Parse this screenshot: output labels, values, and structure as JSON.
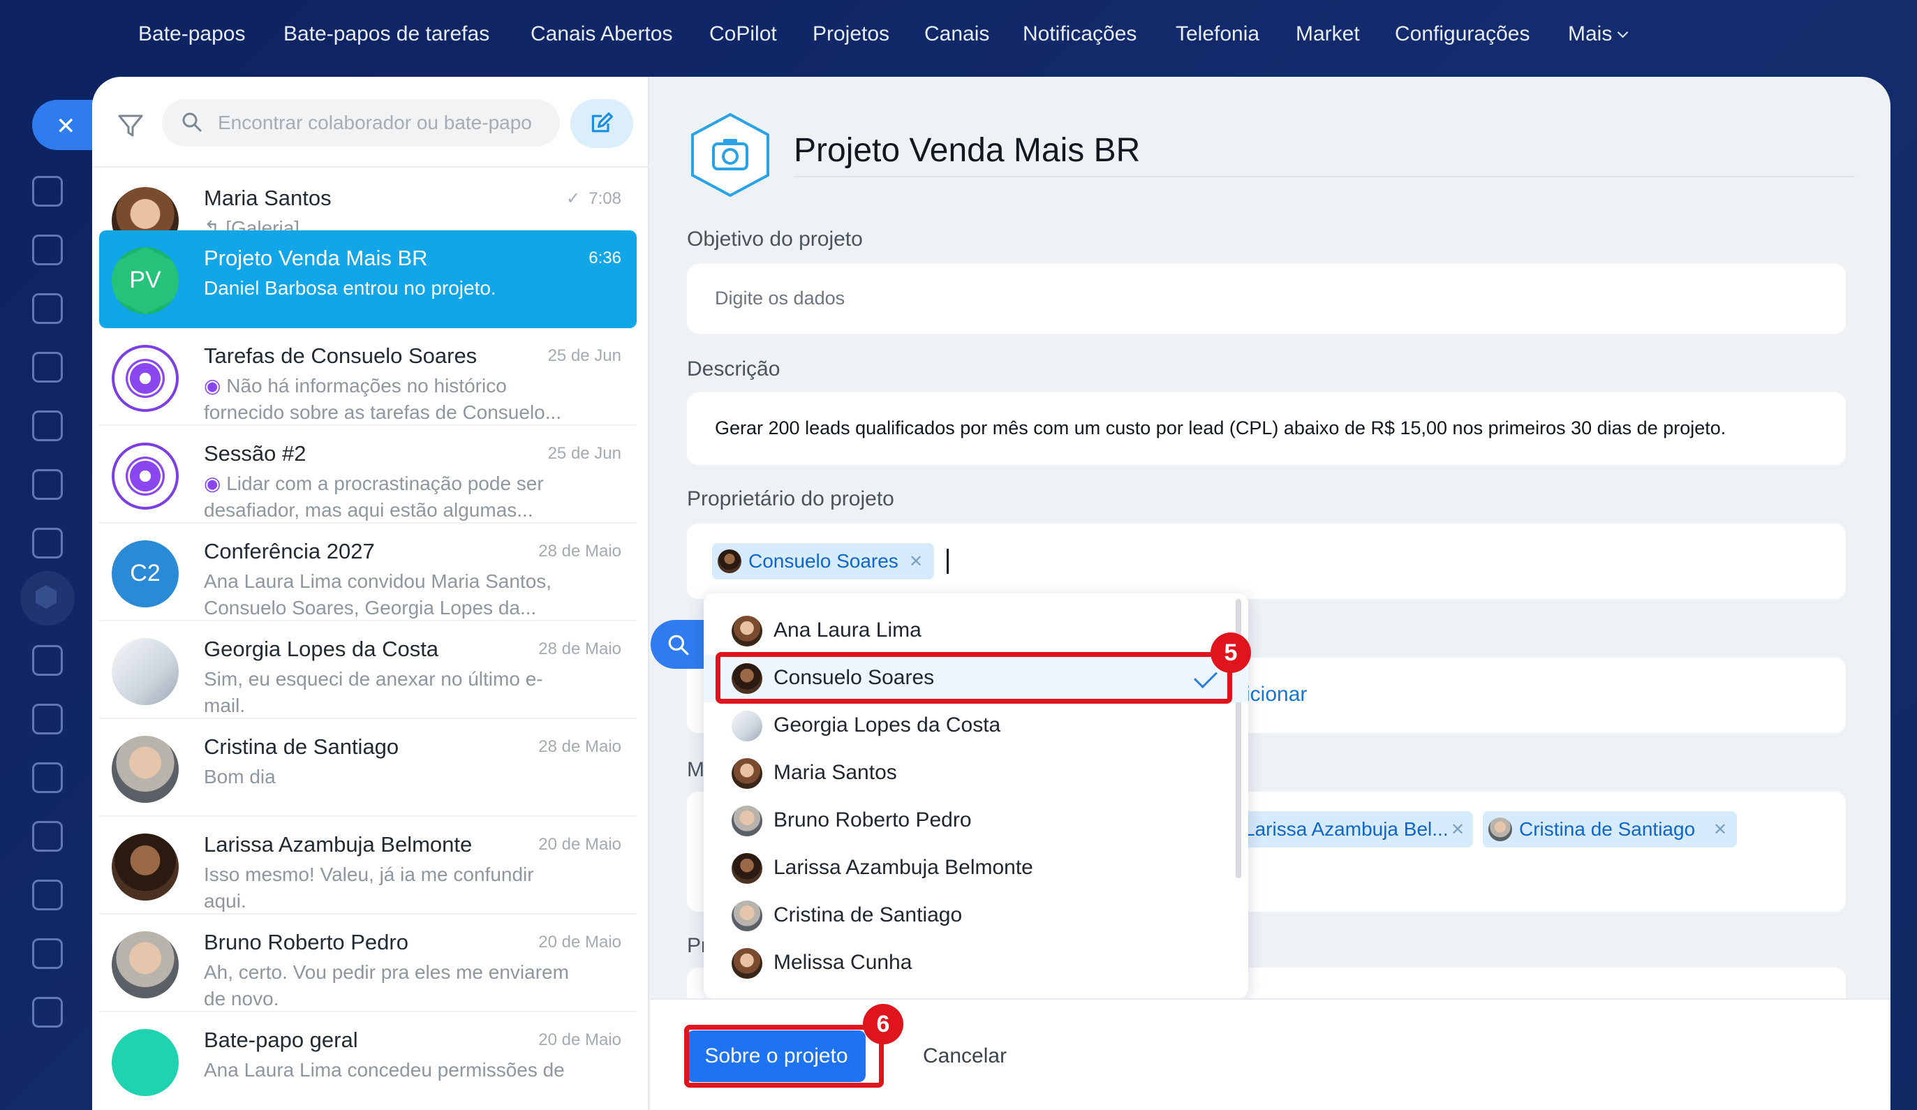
{
  "topnav": {
    "items": [
      "Bate-papos",
      "Bate-papos de tarefas",
      "Canais Abertos",
      "CoPilot",
      "Projetos",
      "Canais",
      "Notificações",
      "Telefonia",
      "Market",
      "Configurações",
      "Mais"
    ]
  },
  "search": {
    "placeholder": "Encontrar colaborador ou bate-papo"
  },
  "chats": [
    {
      "name": "Maria Santos",
      "time": "7:08",
      "message": "[Galeria]"
    },
    {
      "name": "Projeto Venda Mais BR",
      "time": "6:36",
      "message": "Daniel Barbosa entrou no projeto.",
      "avatar_text": "PV"
    },
    {
      "name": "Tarefas de Consuelo Soares",
      "time": "25 de Jun",
      "message": "Não há informações no histórico fornecido sobre as tarefas de Consuelo..."
    },
    {
      "name": "Sessão #2",
      "time": "25 de Jun",
      "message": "Lidar com a procrastinação pode ser desafiador, mas aqui estão algumas..."
    },
    {
      "name": "Conferência 2027",
      "time": "28 de Maio",
      "message": "Ana Laura Lima convidou Maria Santos, Consuelo Soares, Georgia Lopes da...",
      "avatar_text": "C2"
    },
    {
      "name": "Georgia Lopes da Costa",
      "time": "28 de Maio",
      "message": "Sim, eu esqueci de anexar no último e-mail."
    },
    {
      "name": "Cristina de Santiago",
      "time": "28 de Maio",
      "message": "Bom dia"
    },
    {
      "name": "Larissa Azambuja Belmonte",
      "time": "20 de Maio",
      "message": "Isso mesmo! Valeu, já ia me confundir aqui."
    },
    {
      "name": "Bruno Roberto Pedro",
      "time": "20 de Maio",
      "message": "Ah, certo. Vou pedir pra eles me enviarem de novo."
    },
    {
      "name": "Bate-papo geral",
      "time": "20 de Maio",
      "message": "Ana Laura Lima concedeu permissões de"
    }
  ],
  "project": {
    "title": "Projeto Venda Mais BR",
    "objective_label": "Objetivo do projeto",
    "objective_placeholder": "Digite os dados",
    "description_label": "Descrição",
    "description_value": "Gerar 200 leads qualificados por mês com um custo por lead (CPL) abaixo de R$ 15,00 nos primeiros 30 dias de projeto.",
    "owner_label": "Proprietário do projeto",
    "owner_tag": "Consuelo Soares",
    "add_link_partial": "icionar",
    "members_label_partial": "M",
    "member_tags": [
      "Larissa Azambuja Bel...",
      "Cristina de Santiago"
    ],
    "next_label_partial": "Pr"
  },
  "dropdown": {
    "options": [
      "Ana Laura Lima",
      "Consuelo Soares",
      "Georgia Lopes da Costa",
      "Maria Santos",
      "Bruno Roberto Pedro",
      "Larissa Azambuja Belmonte",
      "Cristina de Santiago",
      "Melissa Cunha"
    ],
    "selected": "Consuelo Soares"
  },
  "annotations": {
    "step5": "5",
    "step6": "6"
  },
  "footer": {
    "primary_label": "Sobre o projeto",
    "cancel_label": "Cancelar"
  },
  "colors": {
    "accent": "#1d73f2",
    "active_chat": "#11a6e8",
    "highlight": "#e0141c",
    "nav_bg": "#0d2260"
  }
}
